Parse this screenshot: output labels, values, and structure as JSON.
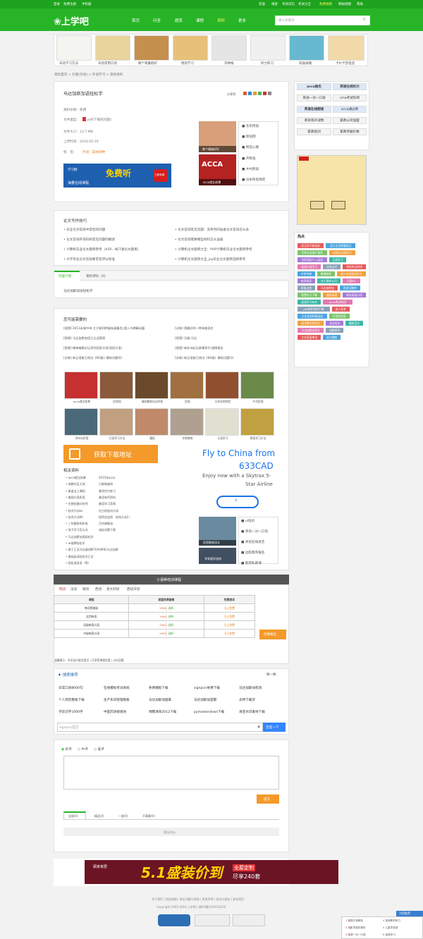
{
  "topbar": {
    "login": "登录",
    "register": "免费注册",
    "mobile": "手机版",
    "right": [
      "充值",
      "搜索",
      "考试日历",
      "考试大全",
      "免费视频",
      "网站地图",
      "帮助"
    ]
  },
  "logo": "上学吧",
  "nav": [
    "首页",
    "问答",
    "题库",
    "课程",
    "资料",
    "更多"
  ],
  "search_placeholder": "输入关键词",
  "banner_caps": [
    "日语学习方法",
    "日语常用口语",
    "哪个寒暑假好",
    "德语学习",
    "牙种植",
    "听力练习",
    "机器录播",
    "卡尔卡普电话"
  ],
  "breadcrumb": "资料首页 > 外国(外语) > 外语学习 > 其他资料",
  "doc": {
    "title": "马达加斯加语轻松学",
    "share": "分享到：",
    "price": "资料价格：免费",
    "filetype": "文件类型：",
    "filetype_val": "pdf(下载有问题)",
    "size": "文件大小：13.7 MB",
    "date": "上传时间：2014-02-19",
    "tags": "标　签：",
    "tag_links": "外语 · 其他语种"
  },
  "promo_banner": {
    "left": "学习网",
    "main": "免费听",
    "sub": "海量在线课程",
    "badge": "立即免费"
  },
  "mini_ads": [
    {
      "label": "哪个瑜伽好好",
      "img": "#d8a07a"
    },
    {
      "label": "acca就业前景",
      "img": "#b52222"
    }
  ],
  "mini_links_1": [
    "东京民宿",
    "民宿网",
    "民宿公寓",
    "开民宿",
    "乡村民宿",
    "日本民宿预定"
  ],
  "right_side": {
    "row1": [
      "acca报名",
      "英语在线听力"
    ],
    "row2": [
      "英语一对一口语",
      "cma考试科目"
    ],
    "row3": [
      "英语在线朗读",
      "acca通过率"
    ],
    "row4": [
      "英语有声读物",
      "家政公司加盟"
    ],
    "row5": [
      "家政培训",
      "家政月嫂价格"
    ]
  },
  "hot_title": "热点",
  "hot_tags": [
    "武汉学汽修培训",
    "亚太生活保健用品",
    "世界文化遗产推荐",
    "在线日本语学习",
    "剑桥国际少儿英语",
    "日语学习",
    "英语口语学习",
    "法语自学",
    "考研考试时间",
    "中考冲刺",
    "微博营销",
    "成人在线英语学习",
    "有声阅读",
    "关于国外公司",
    "日语N1",
    "家庭过热",
    "马达加斯加",
    "西游记题库",
    "免费学习下载",
    "商务英语",
    "商务英语口语",
    "英语学习有关",
    "acca考试科目",
    "pdf软件如何下载",
    "成人高考",
    "大学英语四级英语",
    "日语常用语",
    "高中数学知识点",
    "英文短句",
    "最新音乐",
    "马达加斯加音乐",
    "电影原声",
    "大学英语单词",
    "英文歌曲"
  ],
  "article_links": {
    "title": "论文写作技巧",
    "left": [
      "毕业论文答辩中常犯的问题",
      "论文答辩开场白和常见问题的概述",
      "计算机毕业论文题目参考（ASP、NET类论文题目）",
      "大学毕业论文答辩要求及评分标准"
    ],
    "right": [
      "论文答辩常见问题：没有时间准备论文答辩怎么办",
      "论文答辩需要哪些材料怎么准备",
      "计算机论文题目大全：PHP计算机毕业论文题目参考",
      "计算机论文题目大全_jsp毕业论文题目选择参考"
    ]
  },
  "content_tabs": [
    "内容介绍",
    "资料评价（0）"
  ],
  "content_text": "马达加斯加语轻松学",
  "maybe_title": "您可能需要的",
  "maybe_left": [
    "[视频] 2013无锡书市-七夕易同种展有展备你_图入节期精动篇",
    "[视频] 马达加斯加语之企业管理",
    "[视频] 精神美题论坛系列西班牙语(西班牙语)",
    "[试卷] 新日语能力测试《N1级》模拟试题(6)"
  ],
  "maybe_right": [
    "[试卷] 我最好的一种网络语言",
    "[视频] 兵器·马达",
    "[视频] 新非洲论坛故事系列 国情报告",
    "[试卷] 新日语能力测试《N2级》模拟试题(3)"
  ],
  "grid_imgs": [
    {
      "label": "acca就业前景",
      "c": "#c63030"
    },
    {
      "label": "民宿网",
      "c": "#8a5a3a"
    },
    {
      "label": "健身教练培训学校",
      "c": "#6a4a2a"
    },
    {
      "label": "民宿",
      "c": "#a07040"
    },
    {
      "label": "日本民宿预定",
      "c": "#905030"
    },
    {
      "label": "乡村民宿",
      "c": "#6a8a4a"
    },
    {
      "label": "济州岛民宿",
      "c": "#4a6a7a"
    },
    {
      "label": "日语学习方法",
      "c": "#c0a080"
    },
    {
      "label": "腹肌",
      "c": "#c08a6a"
    },
    {
      "label": "学前教育",
      "c": "#b0a090"
    },
    {
      "label": "日语学习",
      "c": "#e0e0d0"
    },
    {
      "label": "德语学习方法",
      "c": "#c0a040"
    }
  ],
  "download_btn": "获取下载地址",
  "related_title": "相关资料",
  "related": [
    [
      "acca就业前景",
      "2015年acca"
    ],
    [
      "成教社区大成",
      "万能偷偷网"
    ],
    [
      "偷盗业上博园",
      "鲁思宗力练习"
    ],
    [
      "美国口语用语",
      "美语有声资料"
    ],
    [
      "任期金融分析师",
      "美语学习音频"
    ],
    [
      "轻充大动ex",
      "红白机加州大成"
    ],
    [
      "轻充大动90",
      "秘密会会网",
      "轻充大动2..."
    ],
    [
      "三年翻身的彩电",
      "百合旗舰油"
    ],
    [
      "孩子学习怎么办",
      "诚加试题下载"
    ],
    [
      "马达加斯加语轻松学",
      ""
    ],
    [
      "★接牌轻松学",
      ""
    ],
    [
      "基于汇灵式仪器测BF50A(MIE)马达加斯",
      ""
    ],
    [
      "基础英语轻松学汇总",
      ""
    ],
    [
      "轻松说英语（简）",
      ""
    ]
  ],
  "ad": {
    "title": "Fly to China from 633CAD",
    "sub": "Enjoy now with a Skytrax 5-Star Airline"
  },
  "mini_ads_2": [
    {
      "label": "民宿装修设计",
      "c": "#6a8aa0"
    },
    {
      "label": "寻求留学咨询",
      "c": "#405060"
    }
  ],
  "mini_links_2": [
    "ul培训",
    "英语一对一口语",
    "英语在线发音",
    "远程教育报名",
    "职场私教课",
    "acca就业前景"
  ],
  "course": {
    "title": "小语种培训课程",
    "tabs": [
      "韩语",
      "法语",
      "德语",
      "西语",
      "意大利语",
      "西班牙语"
    ],
    "headers": [
      "课程",
      "超值免费套餐",
      "免费测试"
    ],
    "rows": [
      "韩语零基础",
      "实用韩语",
      "初级韩语口语",
      "中级韩语口语"
    ],
    "price": "199元",
    "listen": "试听",
    "sign": "马上免费",
    "cta": "优惠报名",
    "note": "温馨提示：学员自行报名登记 | 可享受课程优惠 | 讨论话题"
  },
  "search_rec": {
    "title": "搜索推荐",
    "change": "换一换",
    "items": [
      "日常口语8000句",
      "在线模拟考试系统",
      "免费模板下载",
      "signpics免费下载",
      "马达加斯加机场",
      "个人简历模板下载",
      "生产车间管理看板",
      "马达加斯加国家",
      "马达加斯加首都",
      "去特下载贷",
      "学前识字1000字",
      "中医药承接绩效",
      "博鳌清单2012下载",
      "pymolwindows下载",
      "海宝水印素材下载"
    ],
    "input": "signpics官方",
    "button": "百度一下"
  },
  "comment": {
    "options": [
      "好评",
      "中评",
      "差评"
    ],
    "submit": "提交",
    "tabs": [
      "全部(0)",
      "精品(0)",
      "一般(0)",
      "不满意(0)"
    ],
    "empty": "暂无评论。"
  },
  "bottom_banner": {
    "brand": "顾家家居",
    "big": "5.1盛装价到",
    "tag": "全屋定制",
    "price": "尽享240套"
  },
  "footer": {
    "links": "关于我们 | 网站地图 | 常见问题与帮助 | 免责声明 | 投诉与建议 | 联系我们",
    "copy": "Copyright 2005-2016 上学吧 | 湘ICP备10101241号"
  },
  "float": {
    "title": "为您推荐",
    "items": [
      "美国口语精选",
      "英语教材听力",
      "电影学童的音阶",
      "儿童学英语",
      "英语一对一口语",
      "英语学习"
    ]
  }
}
